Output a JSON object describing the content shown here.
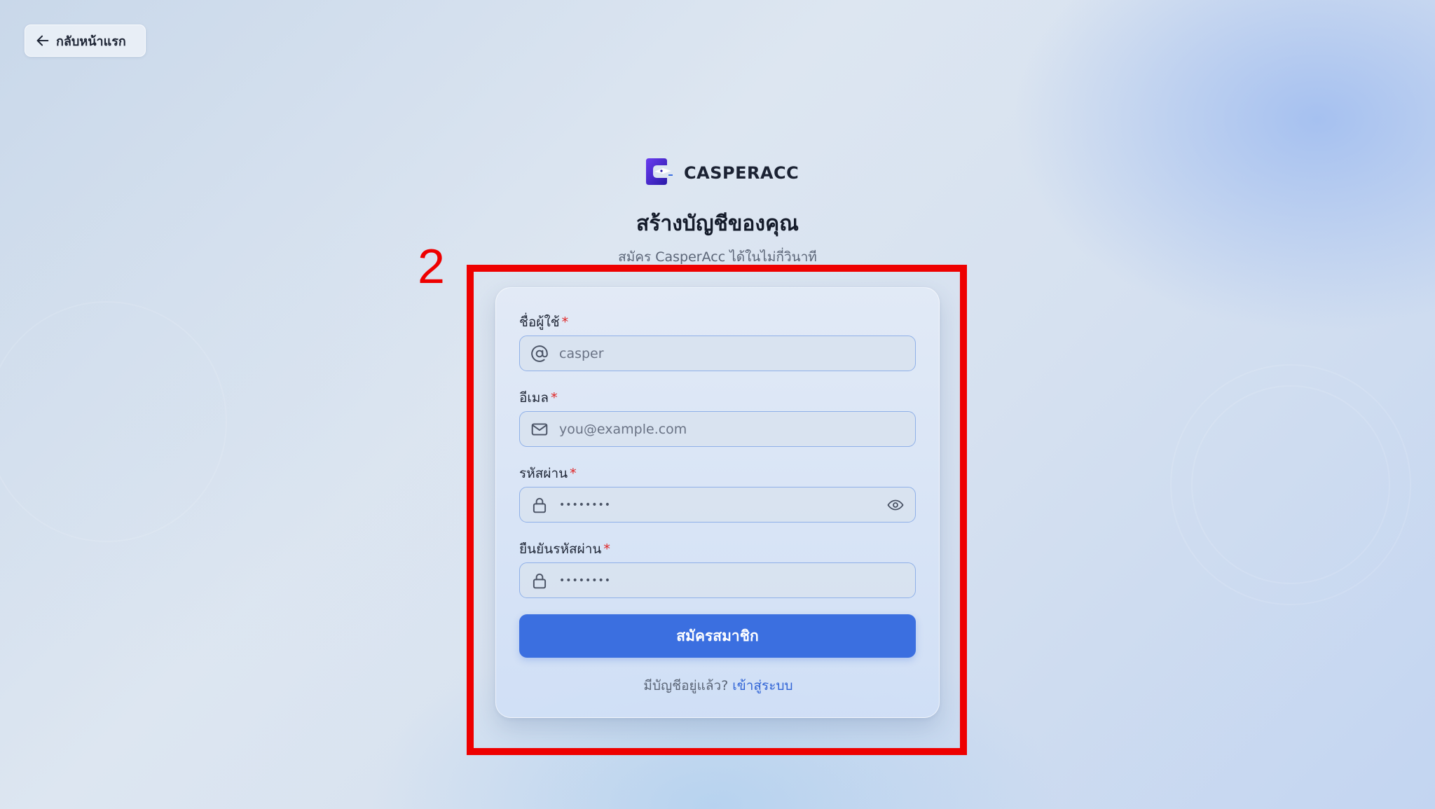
{
  "nav": {
    "back_label": "กลับหน้าแรก",
    "back_icon": "arrow-left-icon"
  },
  "brand": {
    "name": "CASPERACC",
    "logo_icon": "casperacc-logo-icon",
    "logo_color": "#4b2bd0"
  },
  "header": {
    "title": "สร้างบัญชีของคุณ",
    "subtitle": "สมัคร CasperAcc ได้ในไม่กี่วินาที"
  },
  "annotation": {
    "step_number": "2",
    "color": "#ee0000"
  },
  "form": {
    "username": {
      "label": "ชื่อผู้ใช้",
      "required_mark": "*",
      "placeholder": "casper",
      "icon": "at-sign-icon"
    },
    "email": {
      "label": "อีเมล",
      "required_mark": "*",
      "placeholder": "you@example.com",
      "icon": "mail-icon"
    },
    "password": {
      "label": "รหัสผ่าน",
      "required_mark": "*",
      "masked_value": "••••••••",
      "icon": "lock-icon",
      "toggle_icon": "eye-icon"
    },
    "confirm_password": {
      "label": "ยืนยันรหัสผ่าน",
      "required_mark": "*",
      "masked_value": "••••••••",
      "icon": "lock-icon"
    },
    "submit_label": "สมัครสมาชิก",
    "submit_color": "#3b6fe0"
  },
  "footer": {
    "prompt": "มีบัญชีอยู่แล้ว?",
    "signin_link": "เข้าสู่ระบบ"
  }
}
